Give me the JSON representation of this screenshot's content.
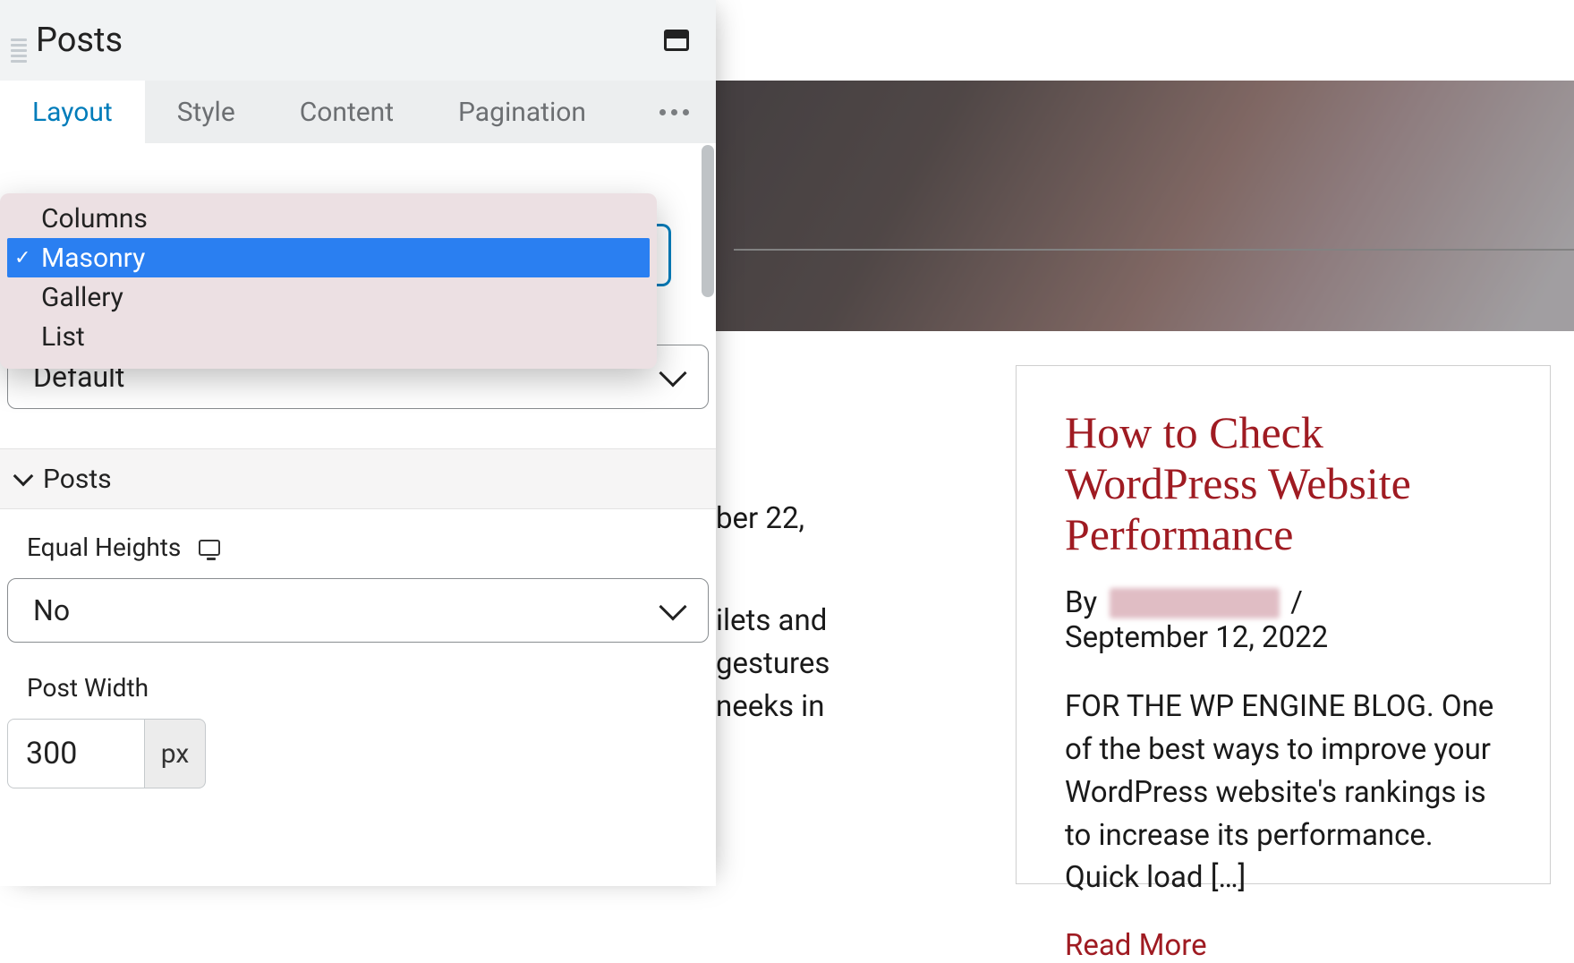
{
  "panel": {
    "title": "Posts",
    "tabs": [
      "Layout",
      "Style",
      "Content",
      "Pagination"
    ],
    "active_tab": 0,
    "select_default": "Default",
    "section": "Posts",
    "equal_heights_label": "Equal Heights",
    "equal_heights_value": "No",
    "post_width_label": "Post Width",
    "post_width_value": "300",
    "post_width_unit": "px"
  },
  "dropdown": {
    "options": [
      "Columns",
      "Masonry",
      "Gallery",
      "List"
    ],
    "selected_index": 1
  },
  "preview": {
    "frag_date": "ber 22,",
    "frag_lines": [
      "ilets and",
      "gestures",
      "neeks in"
    ],
    "card": {
      "title": "How to Check WordPress Website Performance",
      "by": "By",
      "date": "September 12, 2022",
      "body": "FOR THE WP ENGINE BLOG. One of the best ways to improve your WordPress website's rankings is to increase its performance. Quick load […]",
      "read_more": "Read More"
    }
  }
}
